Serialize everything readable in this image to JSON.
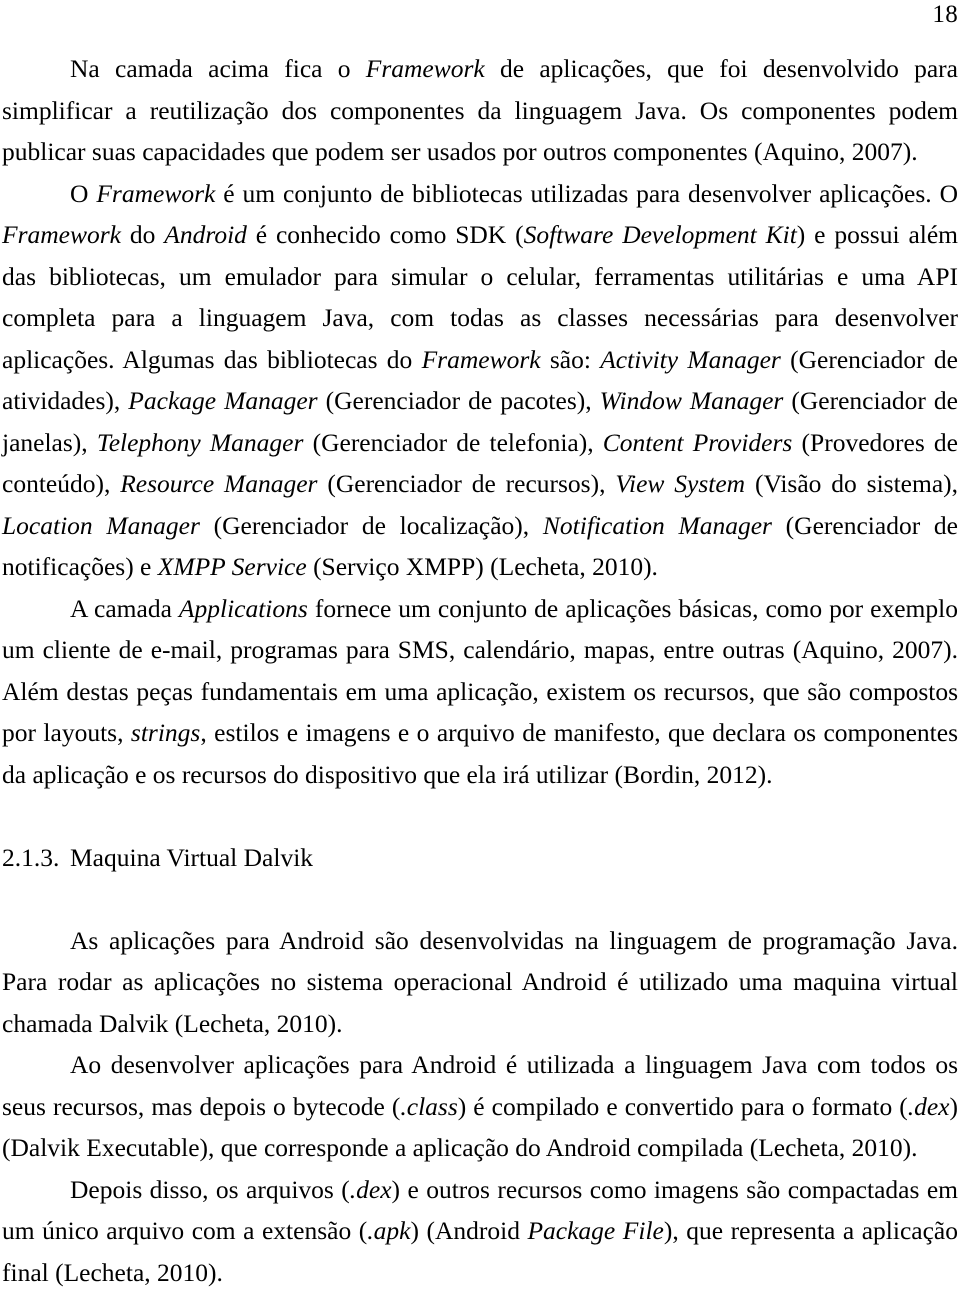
{
  "page": {
    "number": "18",
    "language": "pt-BR"
  },
  "content": {
    "paragraphs": [
      {
        "id": "p1",
        "runs": [
          {
            "text": "Na camada acima fica o ",
            "style": "normal"
          },
          {
            "text": "Framework",
            "style": "italic"
          },
          {
            "text": " de aplicações, que foi desenvolvido para simplificar a reutilização dos componentes da linguagem Java. Os componentes podem publicar suas capacidades que podem ser usados por outros componentes (Aquino, 2007).",
            "style": "normal"
          }
        ]
      },
      {
        "id": "p2",
        "runs": [
          {
            "text": "O ",
            "style": "normal"
          },
          {
            "text": "Framework",
            "style": "italic"
          },
          {
            "text": " é um conjunto de bibliotecas utilizadas para desenvolver aplicações. O ",
            "style": "normal"
          },
          {
            "text": "Framework",
            "style": "italic"
          },
          {
            "text": " do ",
            "style": "normal"
          },
          {
            "text": "Android",
            "style": "italic"
          },
          {
            "text": " é conhecido como SDK (",
            "style": "normal"
          },
          {
            "text": "Software Development Kit",
            "style": "italic"
          },
          {
            "text": ") e possui além das bibliotecas, um emulador para simular o celular, ferramentas utilitárias e uma API completa para a linguagem Java, com todas as classes necessárias para desenvolver aplicações. Algumas das bibliotecas do ",
            "style": "normal"
          },
          {
            "text": "Framework",
            "style": "italic"
          },
          {
            "text": " são: ",
            "style": "normal"
          },
          {
            "text": "Activity Manager",
            "style": "italic"
          },
          {
            "text": " (Gerenciador de atividades), ",
            "style": "normal"
          },
          {
            "text": "Package Manager",
            "style": "italic"
          },
          {
            "text": " (Gerenciador de pacotes), ",
            "style": "normal"
          },
          {
            "text": "Window Manager",
            "style": "italic"
          },
          {
            "text": " (Gerenciador de janelas), ",
            "style": "normal"
          },
          {
            "text": "Telephony Manager",
            "style": "italic"
          },
          {
            "text": " (Gerenciador de telefonia), ",
            "style": "normal"
          },
          {
            "text": "Content Providers",
            "style": "italic"
          },
          {
            "text": " (Provedores de conteúdo), ",
            "style": "normal"
          },
          {
            "text": "Resource Manager",
            "style": "italic"
          },
          {
            "text": " (Gerenciador de recursos), ",
            "style": "normal"
          },
          {
            "text": "View System",
            "style": "italic"
          },
          {
            "text": " (Visão do sistema), ",
            "style": "normal"
          },
          {
            "text": "Location Manager",
            "style": "italic"
          },
          {
            "text": " (Gerenciador de localização), ",
            "style": "normal"
          },
          {
            "text": "Notification Manager",
            "style": "italic"
          },
          {
            "text": " (Gerenciador de notificações) e ",
            "style": "normal"
          },
          {
            "text": "XMPP Service",
            "style": "italic"
          },
          {
            "text": " (Serviço XMPP) (Lecheta, 2010).",
            "style": "normal"
          }
        ]
      },
      {
        "id": "p3",
        "runs": [
          {
            "text": "A camada ",
            "style": "normal"
          },
          {
            "text": "Applications",
            "style": "italic"
          },
          {
            "text": " fornece um conjunto de aplicações básicas, como por exemplo um cliente de e-mail, programas para SMS, calendário, mapas, entre outras (Aquino, 2007). Além destas peças fundamentais em uma aplicação, existem os recursos, que são compostos por layouts, ",
            "style": "normal"
          },
          {
            "text": "strings",
            "style": "italic"
          },
          {
            "text": ", estilos e imagens e o arquivo de manifesto, que declara os componentes da aplicação e os recursos do dispositivo que ela irá utilizar (Bordin, 2012).",
            "style": "normal"
          }
        ]
      }
    ],
    "heading": {
      "number": "2.1.3.",
      "title": "Maquina Virtual Dalvik"
    },
    "paragraphs_after_heading": [
      {
        "id": "p4",
        "runs": [
          {
            "text": "As aplicações para Android são desenvolvidas na linguagem de programação Java. Para rodar as aplicações no sistema operacional Android é utilizado uma maquina virtual chamada Dalvik (Lecheta, 2010).",
            "style": "normal"
          }
        ]
      },
      {
        "id": "p5",
        "runs": [
          {
            "text": "Ao desenvolver aplicações para Android é utilizada a linguagem Java com todos os seus recursos, mas depois o bytecode (",
            "style": "normal"
          },
          {
            "text": ".class",
            "style": "italic"
          },
          {
            "text": ") é compilado e convertido para o formato (",
            "style": "normal"
          },
          {
            "text": ".dex",
            "style": "italic"
          },
          {
            "text": ") (Dalvik Executable), que corresponde a aplicação do Android compilada (Lecheta, 2010).",
            "style": "normal"
          }
        ]
      },
      {
        "id": "p6",
        "runs": [
          {
            "text": "Depois disso, os arquivos (",
            "style": "normal"
          },
          {
            "text": ".dex",
            "style": "italic"
          },
          {
            "text": ") e outros recursos como imagens são compactadas em um único arquivo com a extensão (",
            "style": "normal"
          },
          {
            "text": ".apk",
            "style": "italic"
          },
          {
            "text": ") (Android ",
            "style": "normal"
          },
          {
            "text": "Package File",
            "style": "italic"
          },
          {
            "text": "), que representa a aplicação final (Lecheta, 2010).",
            "style": "normal"
          }
        ]
      }
    ]
  },
  "colors": {
    "page_background": "#ffffff",
    "text": "#000000"
  }
}
